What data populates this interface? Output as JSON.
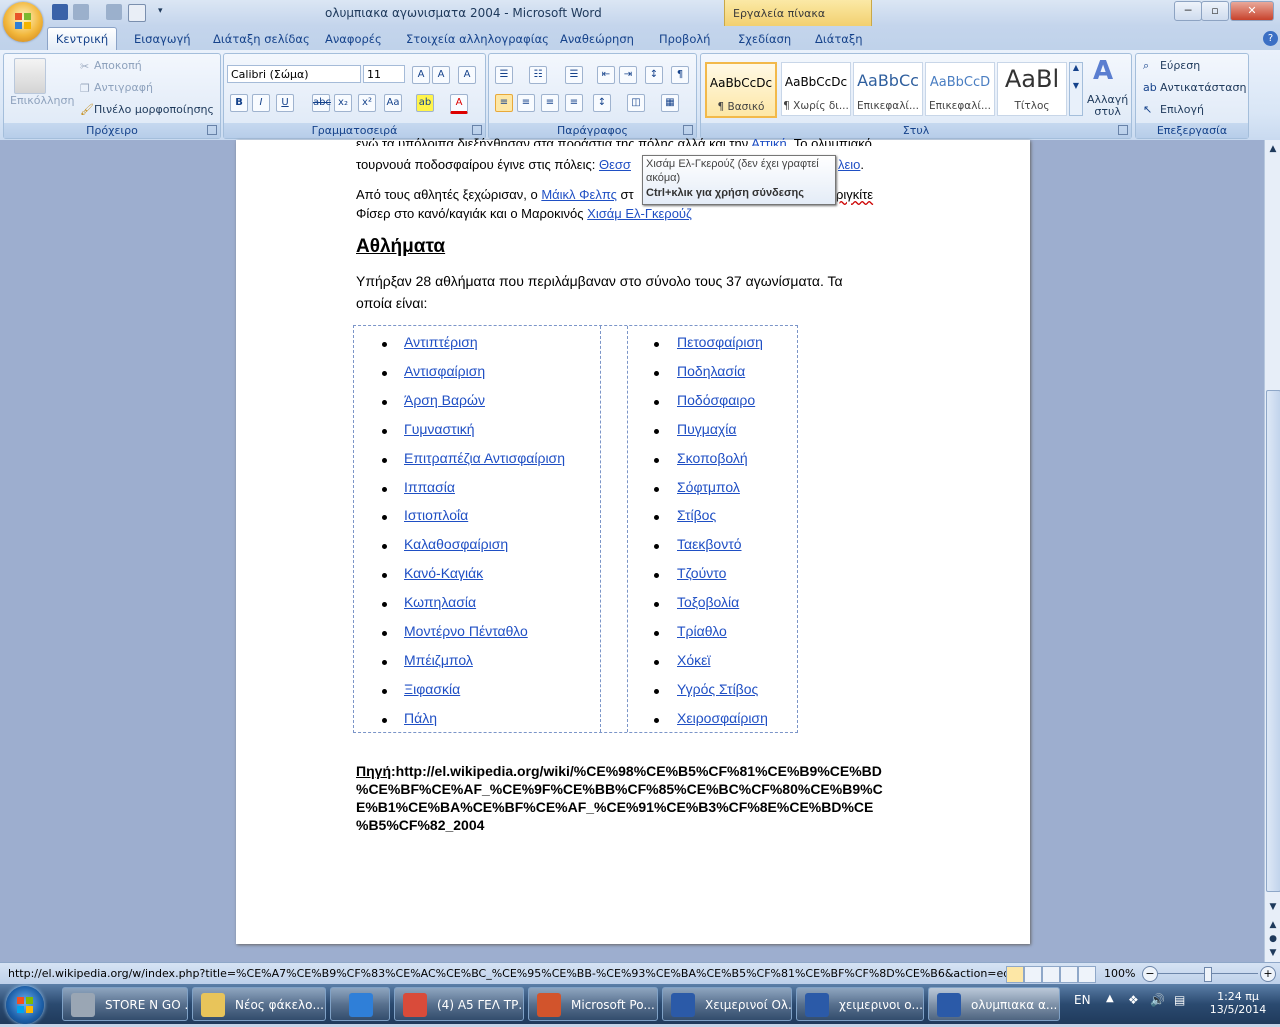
{
  "window": {
    "title": "ολυμπιακα αγωνισματα 2004 - Microsoft Word",
    "context_tab_header": "Εργαλεία πίνακα",
    "minimize": "─",
    "maximize": "▫",
    "close": "✕"
  },
  "tabs": [
    "Κεντρική",
    "Εισαγωγή",
    "Διάταξη σελίδας",
    "Αναφορές",
    "Στοιχεία αλληλογραφίας",
    "Αναθεώρηση",
    "Προβολή",
    "Σχεδίαση",
    "Διάταξη"
  ],
  "ribbon": {
    "clipboard": {
      "label": "Πρόχειρο",
      "paste": "Επικόλληση",
      "cut": "Αποκοπή",
      "copy": "Αντιγραφή",
      "format_painter": "Πινέλο μορφοποίησης"
    },
    "font": {
      "label": "Γραμματοσειρά",
      "font_name": "Calibri (Σώμα)",
      "font_size": "11"
    },
    "paragraph": {
      "label": "Παράγραφος"
    },
    "styles": {
      "label": "Στυλ",
      "items": [
        {
          "sample": "AaBbCcDc",
          "name": "¶ Βασικό"
        },
        {
          "sample": "AaBbCcDc",
          "name": "¶ Χωρίς δι..."
        },
        {
          "sample": "AaBbCc",
          "name": "Επικεφαλί..."
        },
        {
          "sample": "AaBbCcD",
          "name": "Επικεφαλί..."
        },
        {
          "sample": "AaBl",
          "name": "Τίτλος"
        }
      ],
      "change_styles": "Αλλαγή\nστυλ"
    },
    "editing": {
      "label": "Επεξεργασία",
      "find": "Εύρεση",
      "replace": "Αντικατάσταση",
      "select": "Επιλογή"
    }
  },
  "document": {
    "line1_partial": "ενώ τα υπόλοιπα διεξήχθησαν στα προάστια της πόλης αλλά και την",
    "line1_link": "Αττική",
    "line1_end": ". Το ολυμπιακό",
    "line2_start": "τουρνουά ποδοσφαίρου έγινε στις πόλεις:",
    "line2_link1": "Θεσσ",
    "line2_link2": "λειο",
    "line3_start": "Από τους αθλητές ξεχώρισαν, ο",
    "line3_link": "Μάικλ Φελπς",
    "line3_mid": "στ",
    "line3_end": "ριγκίτε",
    "line4_start": "Φίσερ στο κανό/καγιάκ και ο Μαροκινός",
    "line4_link": "Χισάμ Ελ-Γκερούζ",
    "heading": "Αθλήματα",
    "para_line1": "Υπήρξαν 28 αθλήματα που περιλάμβαναν στο σύνολο τους 37 αγωνίσματα. Τα",
    "para_line2": "οποία είναι:",
    "sports_left": [
      "Αντιπτέριση",
      "Αντισφαίριση",
      "Άρση Βαρών",
      "Γυμναστική",
      "Επιτραπέζια Αντισφαίριση",
      "Ιππασία",
      "Ιστιοπλοΐα",
      "Καλαθοσφαίριση",
      "Κανό-Καγιάκ",
      "Κωπηλασία",
      "Μοντέρνο Πένταθλο",
      "Μπέιζμπολ",
      "Ξιφασκία",
      "Πάλη"
    ],
    "sports_right": [
      "Πετοσφαίριση",
      "Ποδηλασία",
      "Ποδόσφαιρο",
      "Πυγμαχία",
      "Σκοποβολή",
      "Σόφτμπολ",
      "Στίβος",
      "Ταεκβοντό",
      "Τζούντο",
      "Τοξοβολία",
      "Τρίαθλο",
      "Χόκεϊ",
      "Υγρός Στίβος",
      "Χειροσφαίριση"
    ],
    "source_label": "Πηγή",
    "source_lines": [
      ":http://el.wikipedia.org/wiki/%CE%98%CE%B5%CF%81%CE%B9%CE%BD",
      "%CE%BF%CE%AF_%CE%9F%CE%BB%CF%85%CE%BC%CF%80%CE%B9%C",
      "E%B1%CE%BA%CE%BF%CE%AF_%CE%91%CE%B3%CF%8E%CE%BD%CE",
      "%B5%CF%82_2004"
    ]
  },
  "tooltip": {
    "line1": "Χισάμ Ελ-Γκερούζ (δεν έχει γραφτεί",
    "line2": "ακόμα)",
    "line3": "Ctrl+κλικ για χρήση σύνδεσης"
  },
  "statusbar": {
    "url": "http://el.wikipedia.org/w/index.php?title=%CE%A7%CE%B9%CF%83%CE%AC%CE%BC_%CE%95%CE%BB-%CE%93%CE%BA%CE%B5%CF%81%CE%BF%CF%8D%CE%B6&action=edit&redlink=1",
    "zoom": "100%"
  },
  "taskbar": {
    "items": [
      {
        "label": "STORE N GO ...",
        "color": "#9aa6b4"
      },
      {
        "label": "Νέος φάκελο...",
        "color": "#e8c45a"
      },
      {
        "label": "",
        "color": "#2f7fd8"
      },
      {
        "label": "(4) Α5 ΓΕΛ ΤΡ...",
        "color": "#d94b3a"
      },
      {
        "label": "Microsoft Po...",
        "color": "#d2542c"
      },
      {
        "label": "Χειμερινοί Ολ...",
        "color": "#2b5aa8"
      },
      {
        "label": "χειμερινοι ο...",
        "color": "#2b5aa8"
      },
      {
        "label": "ολυμπιακα α...",
        "color": "#2b5aa8"
      }
    ],
    "language": "EN",
    "time": "1:24 πμ",
    "date": "13/5/2014"
  }
}
